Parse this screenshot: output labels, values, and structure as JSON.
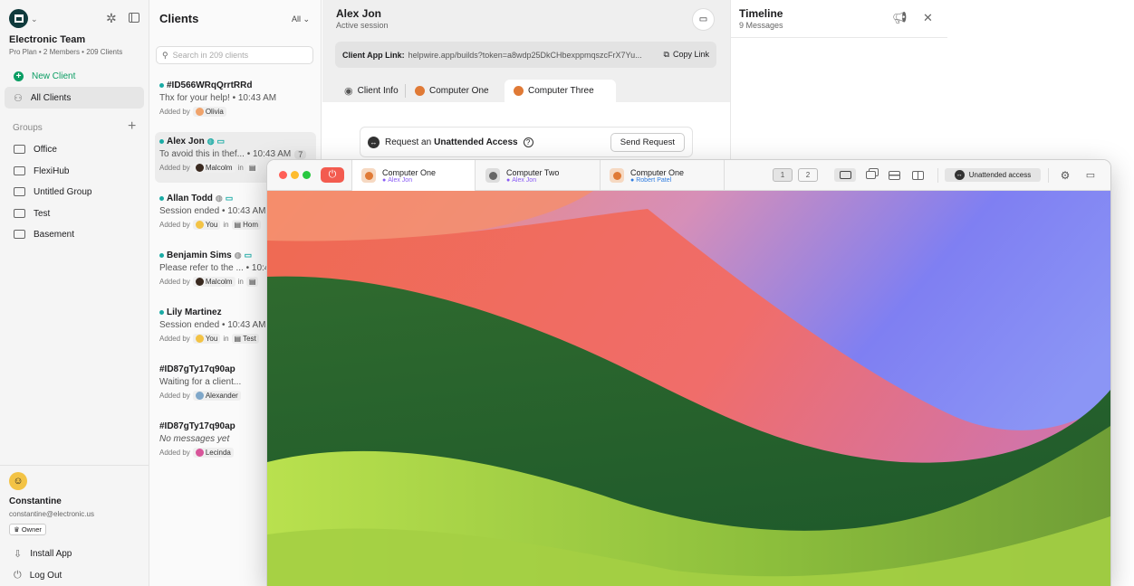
{
  "sidebar": {
    "team": "Electronic Team",
    "plan": "Pro Plan • 2 Members • 209 Clients",
    "new_client": "New Client",
    "all_clients": "All Clients",
    "groups_label": "Groups",
    "groups": [
      "Office",
      "FlexiHub",
      "Untitled Group",
      "Test",
      "Basement"
    ],
    "user": {
      "name": "Constantine",
      "email": "constantine@electronic.us",
      "role": "Owner"
    },
    "install": "Install App",
    "logout": "Log Out"
  },
  "clients": {
    "title": "Clients",
    "filter": "All",
    "search_placeholder": "Search in 209 clients",
    "items": [
      {
        "title": "#ID566WRqQrrtRRd",
        "msg": "Thx for your help! • 10:43 AM",
        "added_by": "Added by",
        "who": "Olivia",
        "in": "",
        "group": ""
      },
      {
        "title": "Alex Jon",
        "msg": "To avoid this in thef... • 10:43 AM",
        "badge": "7",
        "added_by": "Added by",
        "who": "Malcolm",
        "in": "in",
        "group": ""
      },
      {
        "title": "Allan Todd",
        "msg": "Session ended • 10:43 AM",
        "added_by": "Added by",
        "who": "You",
        "in": "in",
        "group": "Hom"
      },
      {
        "title": "Benjamin Sims",
        "msg": "Please refer to the ... • 10:4",
        "added_by": "Added by",
        "who": "Malcolm",
        "in": "in",
        "group": ""
      },
      {
        "title": "Lily Martinez",
        "msg": "Session ended • 10:43 AM",
        "added_by": "Added by",
        "who": "You",
        "in": "in",
        "group": "Test"
      },
      {
        "title": "#ID87gTy17q90ap",
        "msg": "Waiting for a client...",
        "added_by": "Added by",
        "who": "Alexander",
        "in": "",
        "group": ""
      },
      {
        "title": "#ID87gTy17q90ap",
        "msg": "No messages yet",
        "added_by": "Added by",
        "who": "Lecinda",
        "in": "",
        "group": ""
      }
    ]
  },
  "session": {
    "name": "Alex Jon",
    "status": "Active session",
    "link_label": "Client App Link:",
    "link_url": "helpwire.app/builds?token=a8wdp25DkCHbexppmqszcFrX7Yu...",
    "copy_label": "Copy Link",
    "tabs": [
      "Client Info",
      "Computer One",
      "Computer Three"
    ],
    "request_prefix": "Request an",
    "request_strong": "Unattended Access",
    "request_button": "Send Request"
  },
  "timeline": {
    "title": "Timeline",
    "count": "9 Messages"
  },
  "viewer": {
    "tabs": [
      {
        "name": "Computer One",
        "user": "Alex Jon",
        "color": "#8a5cf6"
      },
      {
        "name": "Computer Two",
        "user": "Alex Jon",
        "color": "#8a5cf6"
      },
      {
        "name": "Computer One",
        "user": "Robert Patel",
        "color": "#2f7de1"
      }
    ],
    "monitors": [
      "1",
      "2"
    ],
    "unattended": "Unattended access"
  },
  "colors": {
    "accent": "#0a9d63",
    "teal": "#1aaba5",
    "power": "#f35b4f"
  }
}
